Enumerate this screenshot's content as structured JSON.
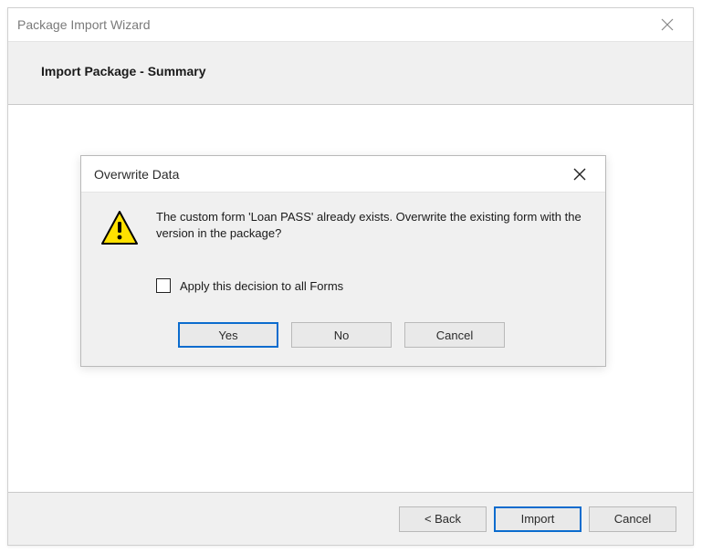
{
  "window": {
    "title": "Package Import Wizard",
    "header_title": "Import Package - Summary"
  },
  "footer": {
    "back": "< Back",
    "import": "Import",
    "cancel": "Cancel"
  },
  "dialog": {
    "title": "Overwrite Data",
    "message": "The custom form 'Loan PASS' already exists. Overwrite the existing form with the version in the package?",
    "checkbox_label": "Apply this decision to all Forms",
    "yes": "Yes",
    "no": "No",
    "cancel": "Cancel"
  }
}
